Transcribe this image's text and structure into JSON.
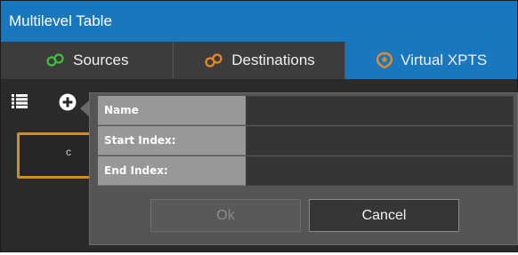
{
  "window": {
    "title": "Multilevel Table"
  },
  "tabs": [
    {
      "label": "Sources",
      "icon": "sources-icon",
      "icon_color": "#3cbf3c",
      "active": false
    },
    {
      "label": "Destinations",
      "icon": "destinations-icon",
      "icon_color": "#e8892a",
      "active": false
    },
    {
      "label": "Virtual XPTS",
      "icon": "virtual-xpts-icon",
      "icon_color": "#e8892a",
      "active": true
    }
  ],
  "toolbar": {
    "list_icon": "list-icon",
    "add_icon": "add-circle-icon"
  },
  "background_card": {
    "text": "c",
    "border_color": "#d9891f"
  },
  "popup": {
    "fields": [
      {
        "label": "Name",
        "value": ""
      },
      {
        "label": "Start Index:",
        "value": ""
      },
      {
        "label": "End Index:",
        "value": ""
      }
    ],
    "ok_label": "Ok",
    "cancel_label": "Cancel"
  },
  "colors": {
    "accent": "#1877bd",
    "highlight": "#d9891f"
  }
}
